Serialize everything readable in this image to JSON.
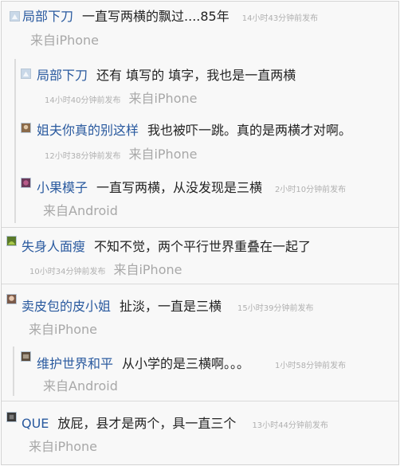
{
  "comments": [
    {
      "name": "局部下刀",
      "text": "一直写两横的飘过....85年",
      "time": "14小时43分钟前发布",
      "source": "来自iPhone",
      "avatar_color": "#c9d8e8",
      "replies": [
        {
          "name": "局部下刀",
          "text": "还有 填写的 填字，我也是一直两横",
          "time": "14小时40分钟前发布",
          "source": "来自iPhone",
          "avatar_color": "#c9d8e8"
        },
        {
          "name": "姐夫你真的别这样",
          "text": "我也被吓一跳。真的是两横才对啊。",
          "time": "12小时38分钟前发布",
          "source": "来自iPhone",
          "avatar_color": "#8a6a4a"
        },
        {
          "name": "小果模子",
          "text": "一直写两横，从没发现是三横",
          "time": "2小时10分钟前发布",
          "source": "来自Android",
          "avatar_color": "#6a3a5a"
        }
      ]
    },
    {
      "name": "失身人面瘦",
      "text": "不知不觉，两个平行世界重叠在一起了",
      "time": "10小时34分钟前发布",
      "source": "来自iPhone",
      "avatar_color": "#5a7a2a",
      "replies": []
    },
    {
      "name": "卖皮包的皮小姐",
      "text": "扯淡，一直是三横",
      "time": "15小时39分钟前发布",
      "source": "来自iPhone",
      "avatar_color": "#7a5a4a",
      "replies": [
        {
          "name": "维护世界和平",
          "text": "从小学的是三横啊。。。",
          "time": "1小时58分钟前发布",
          "source": "来自Android",
          "avatar_color": "#5a4a3a"
        }
      ]
    },
    {
      "name": "QUE",
      "text": "放屁，县才是两个，具一直三个",
      "time": "13小时44分钟前发布",
      "source": "来自iPhone",
      "avatar_color": "#3a3a3a",
      "replies": []
    }
  ]
}
